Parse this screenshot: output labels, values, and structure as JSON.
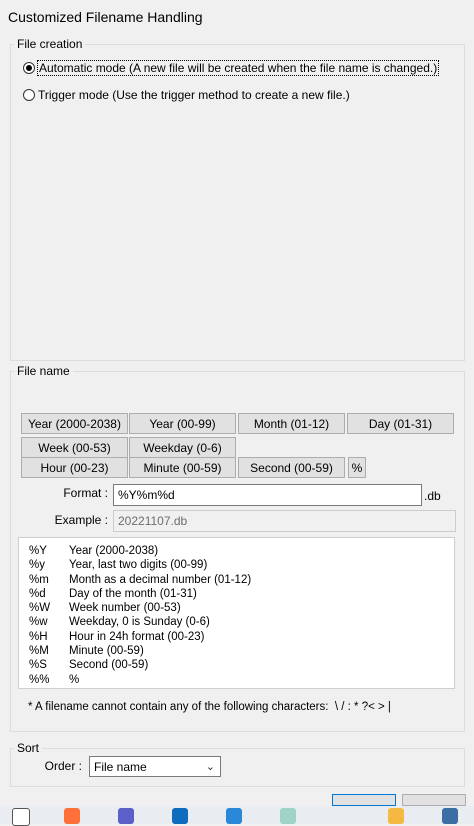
{
  "window": {
    "title": "Customized Filename Handling"
  },
  "file_creation": {
    "legend": "File creation",
    "options": [
      {
        "label": "Automatic mode (A new file will be created when the file name is changed.)",
        "selected": true
      },
      {
        "label": "Trigger mode (Use the trigger method to create a new file.)",
        "selected": false
      }
    ]
  },
  "file_name": {
    "legend": "File name",
    "buttons": [
      "Year (2000-2038)",
      "Year (00-99)",
      "Month (01-12)",
      "Day (01-31)",
      "Week (00-53)",
      "Weekday (0-6)",
      "Hour (00-23)",
      "Minute (00-59)",
      "Second (00-59)",
      "%"
    ],
    "format_label": "Format :",
    "format_value": "%Y%m%d",
    "format_suffix": ".db",
    "example_label": "Example :",
    "example_value": "20221107.db",
    "codes": [
      {
        "code": "%Y",
        "desc": "Year (2000-2038)"
      },
      {
        "code": "%y",
        "desc": "Year, last two digits (00-99)"
      },
      {
        "code": "%m",
        "desc": "Month as a decimal number (01-12)"
      },
      {
        "code": "%d",
        "desc": "Day of the month (01-31)"
      },
      {
        "code": "%W",
        "desc": "Week number (00-53)"
      },
      {
        "code": "%w",
        "desc": "Weekday, 0 is Sunday (0-6)"
      },
      {
        "code": "%H",
        "desc": "Hour in 24h format (00-23)"
      },
      {
        "code": "%M",
        "desc": "Minute (00-59)"
      },
      {
        "code": "%S",
        "desc": "Second (00-59)"
      },
      {
        "code": "%%",
        "desc": "%"
      }
    ],
    "note": "* A filename cannot contain any of the following characters:  \\ / : * ?< > |"
  },
  "sort": {
    "legend": "Sort",
    "order_label": "Order :",
    "order_value": "File name"
  },
  "taskbar": {
    "icons": [
      "file-explorer-icon",
      "firefox-icon",
      "teams-icon",
      "outlook-icon",
      "photos-icon",
      "notes-icon",
      "paint-icon",
      "app-icon"
    ]
  }
}
